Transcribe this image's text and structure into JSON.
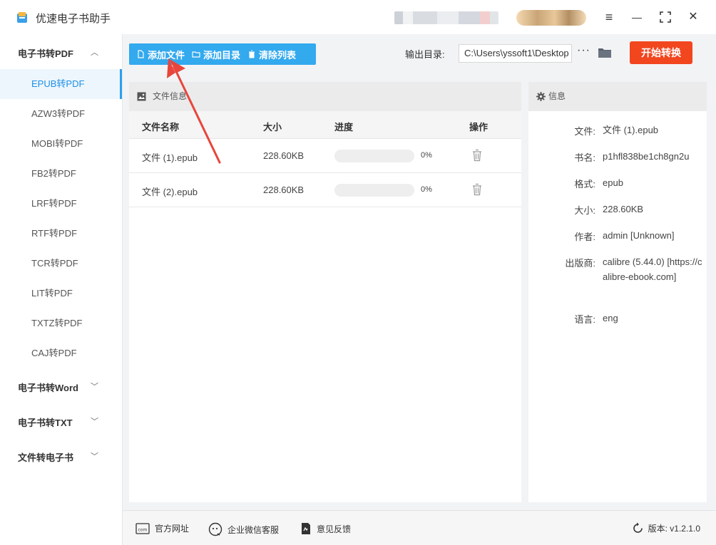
{
  "app": {
    "title": "优速电子书助手"
  },
  "window_controls": {
    "menu": "≡",
    "minimize": "—",
    "maximize": "⛶",
    "close": "✕"
  },
  "sidebar": {
    "categories": [
      {
        "label": "电子书转PDF",
        "expanded": true
      },
      {
        "label": "电子书转Word",
        "expanded": false
      },
      {
        "label": "电子书转TXT",
        "expanded": false
      },
      {
        "label": "文件转电子书",
        "expanded": false
      }
    ],
    "items": [
      {
        "label": "EPUB转PDF",
        "active": true
      },
      {
        "label": "AZW3转PDF"
      },
      {
        "label": "MOBI转PDF"
      },
      {
        "label": "FB2转PDF"
      },
      {
        "label": "LRF转PDF"
      },
      {
        "label": "RTF转PDF"
      },
      {
        "label": "TCR转PDF"
      },
      {
        "label": "LIT转PDF"
      },
      {
        "label": "TXTZ转PDF"
      },
      {
        "label": "CAJ转PDF"
      }
    ]
  },
  "toolbar": {
    "add_file": "添加文件",
    "add_dir": "添加目录",
    "clear_list": "清除列表",
    "output_label": "输出目录:",
    "output_path": "C:\\Users\\yssoft1\\Desktop",
    "more": "···",
    "start": "开始转换"
  },
  "file_panel": {
    "title": "文件信息",
    "columns": [
      "文件名称",
      "大小",
      "进度",
      "操作"
    ],
    "rows": [
      {
        "name": "文件 (1).epub",
        "size": "228.60KB",
        "progress": 0,
        "progress_label": "0%"
      },
      {
        "name": "文件 (2).epub",
        "size": "228.60KB",
        "progress": 0,
        "progress_label": "0%"
      }
    ]
  },
  "info_panel": {
    "title": "信息",
    "fields": [
      {
        "key": "文件:",
        "value": "文件 (1).epub"
      },
      {
        "key": "书名:",
        "value": "p1hfl838be1ch8gn2u"
      },
      {
        "key": "格式:",
        "value": "epub"
      },
      {
        "key": "大小:",
        "value": "228.60KB"
      },
      {
        "key": "作者:",
        "value": "admin [Unknown]"
      },
      {
        "key": "出版商:",
        "value": "calibre (5.44.0) [https://calibre-ebook.com]"
      },
      {
        "key": "语言:",
        "value": "eng"
      }
    ]
  },
  "footer": {
    "website": "官方网址",
    "wechat": "企业微信客服",
    "feedback": "意见反馈",
    "version": "版本: v1.2.1.0"
  },
  "colors": {
    "accent": "#33a9ee",
    "start": "#f2461f",
    "annotation": "#e8453c"
  }
}
